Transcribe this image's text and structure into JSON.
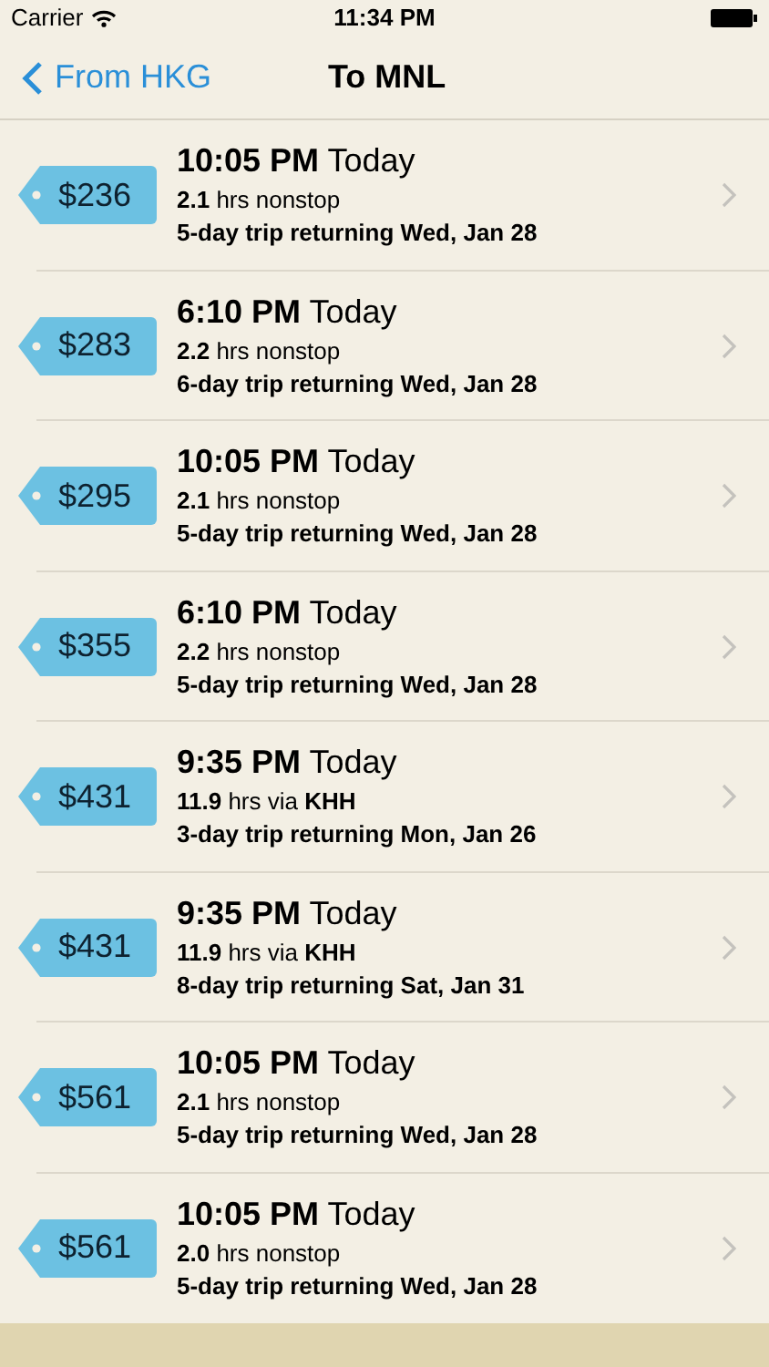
{
  "status_bar": {
    "carrier": "Carrier",
    "time": "11:34 PM"
  },
  "nav": {
    "back": "From HKG",
    "title": "To MNL"
  },
  "flights": [
    {
      "price": "$236",
      "departure": "**10:05 PM** Today",
      "duration": "**2.1** hrs nonstop",
      "trip": "5-day trip returning Wed, Jan 28"
    },
    {
      "price": "$283",
      "departure": "**6:10 PM** Today",
      "duration": "**2.2** hrs nonstop",
      "trip": "6-day trip returning Wed, Jan 28"
    },
    {
      "price": "$295",
      "departure": "**10:05 PM** Today",
      "duration": "**2.1** hrs nonstop",
      "trip": "5-day trip returning Wed, Jan 28"
    },
    {
      "price": "$355",
      "departure": "**6:10 PM** Today",
      "duration": "**2.2** hrs nonstop",
      "trip": "5-day trip returning Wed, Jan 28"
    },
    {
      "price": "$431",
      "departure": "**9:35 PM** Today",
      "duration": "**11.9** hrs via **KHH**",
      "trip": "3-day trip returning Mon, Jan 26"
    },
    {
      "price": "$431",
      "departure": "**9:35 PM** Today",
      "duration": "**11.9** hrs via **KHH**",
      "trip": "8-day trip returning Sat, Jan 31"
    },
    {
      "price": "$561",
      "departure": "**10:05 PM** Today",
      "duration": "**2.1** hrs nonstop",
      "trip": "5-day trip returning Wed, Jan 28"
    },
    {
      "price": "$561",
      "departure": "**10:05 PM** Today",
      "duration": "**2.0** hrs nonstop",
      "trip": "5-day trip returning Wed, Jan 28"
    }
  ]
}
